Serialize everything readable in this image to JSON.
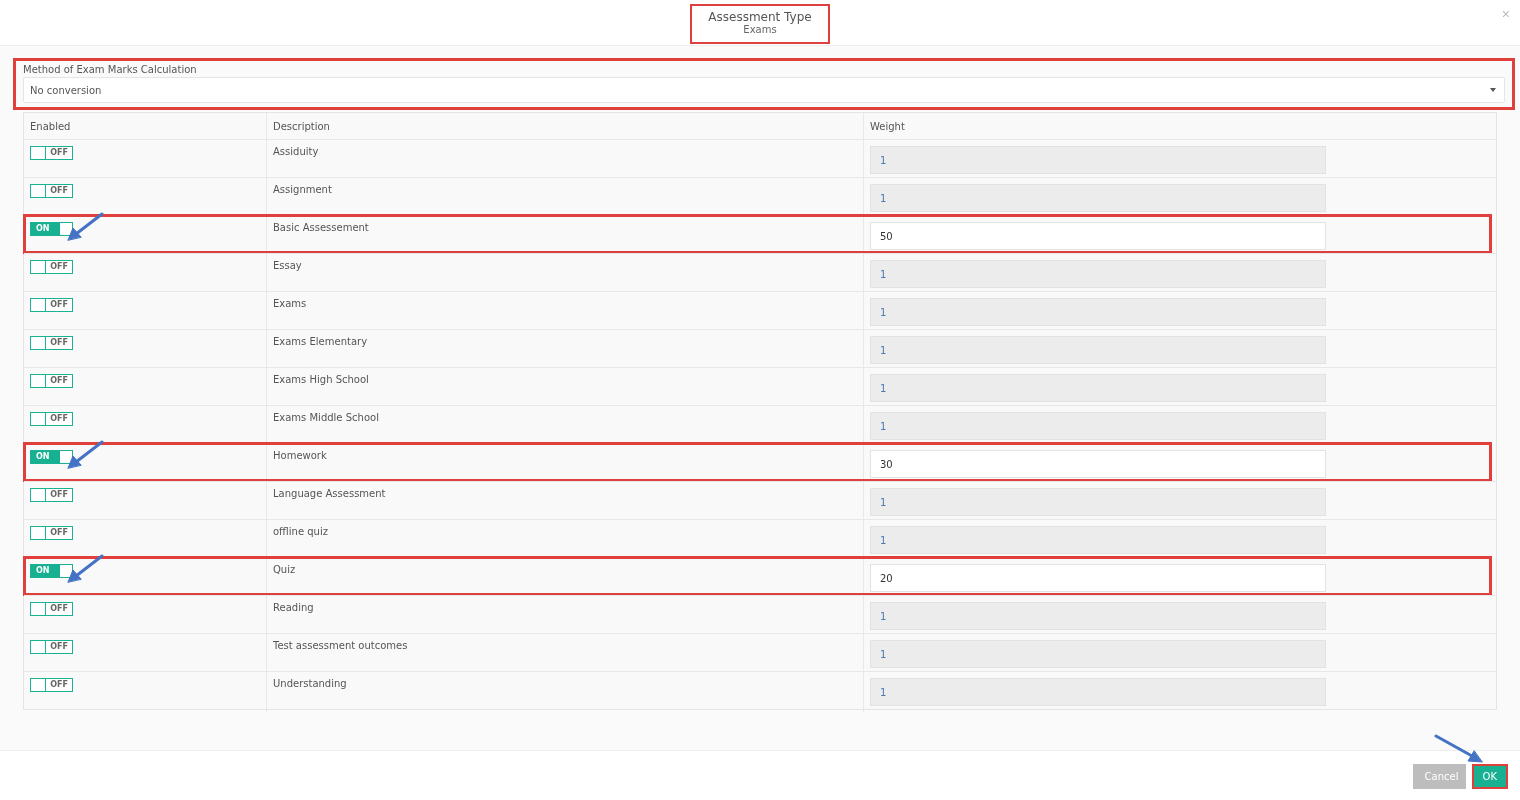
{
  "dialog": {
    "title": "Assessment Type",
    "subtitle": "Exams",
    "title_highlighted": true,
    "close": "×"
  },
  "method": {
    "label": "Method of Exam Marks Calculation",
    "value": "No conversion",
    "highlighted": true
  },
  "table": {
    "columns": [
      "Enabled",
      "Description",
      "Weight"
    ],
    "rows": [
      {
        "on": false,
        "toggle": "OFF",
        "description": "Assiduity",
        "weight": "1",
        "highlighted": false
      },
      {
        "on": false,
        "toggle": "OFF",
        "description": "Assignment",
        "weight": "1",
        "highlighted": false
      },
      {
        "on": true,
        "toggle": "ON",
        "description": "Basic Assessement",
        "weight": "50",
        "highlighted": true
      },
      {
        "on": false,
        "toggle": "OFF",
        "description": "Essay",
        "weight": "1",
        "highlighted": false
      },
      {
        "on": false,
        "toggle": "OFF",
        "description": "Exams",
        "weight": "1",
        "highlighted": false
      },
      {
        "on": false,
        "toggle": "OFF",
        "description": "Exams Elementary",
        "weight": "1",
        "highlighted": false
      },
      {
        "on": false,
        "toggle": "OFF",
        "description": "Exams High School",
        "weight": "1",
        "highlighted": false
      },
      {
        "on": false,
        "toggle": "OFF",
        "description": "Exams Middle School",
        "weight": "1",
        "highlighted": false
      },
      {
        "on": true,
        "toggle": "ON",
        "description": "Homework",
        "weight": "30",
        "highlighted": true
      },
      {
        "on": false,
        "toggle": "OFF",
        "description": "Language Assessment",
        "weight": "1",
        "highlighted": false
      },
      {
        "on": false,
        "toggle": "OFF",
        "description": "offline quiz",
        "weight": "1",
        "highlighted": false
      },
      {
        "on": true,
        "toggle": "ON",
        "description": "Quiz",
        "weight": "20",
        "highlighted": true
      },
      {
        "on": false,
        "toggle": "OFF",
        "description": "Reading",
        "weight": "1",
        "highlighted": false
      },
      {
        "on": false,
        "toggle": "OFF",
        "description": "Test assessment outcomes",
        "weight": "1",
        "highlighted": false
      },
      {
        "on": false,
        "toggle": "OFF",
        "description": "Understanding",
        "weight": "1",
        "highlighted": false
      }
    ]
  },
  "buttons": [
    {
      "label": "Cancel",
      "kind": "secondary",
      "highlighted": false
    },
    {
      "label": "OK",
      "kind": "primary",
      "highlighted": true
    }
  ]
}
